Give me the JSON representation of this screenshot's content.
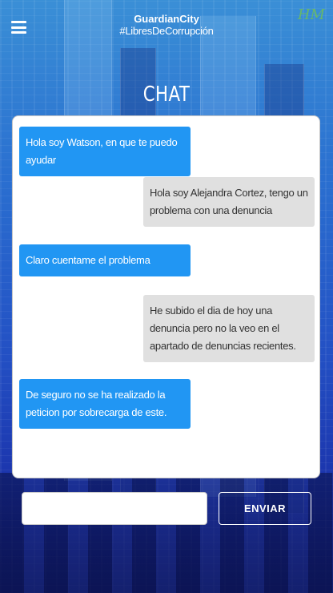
{
  "header": {
    "menu_icon": "hamburger-menu-icon",
    "brand_name": "GuardianCity",
    "brand_tag": "#LibresDeCorrupción",
    "logo_text": "HM"
  },
  "title": "CHAT",
  "messages": [
    {
      "sender": "bot",
      "text": "Hola soy Watson, en que te puedo ayudar"
    },
    {
      "sender": "user",
      "text": "Hola soy Alejandra Cortez, tengo un problema con una denuncia"
    },
    {
      "sender": "bot",
      "text": "Claro cuentame el problema"
    },
    {
      "sender": "user",
      "text": "He subido el dia de hoy una denuncia pero no la veo en el apartado de denuncias recientes."
    },
    {
      "sender": "bot",
      "text": "De seguro no se ha realizado la peticion por sobrecarga de este."
    }
  ],
  "composer": {
    "input_value": "",
    "send_label": "ENVIAR"
  },
  "colors": {
    "bot_bubble": "#2196f3",
    "user_bubble": "#e0e0e0",
    "background_top": "#3a8fd6",
    "background_bottom": "#16208a"
  }
}
